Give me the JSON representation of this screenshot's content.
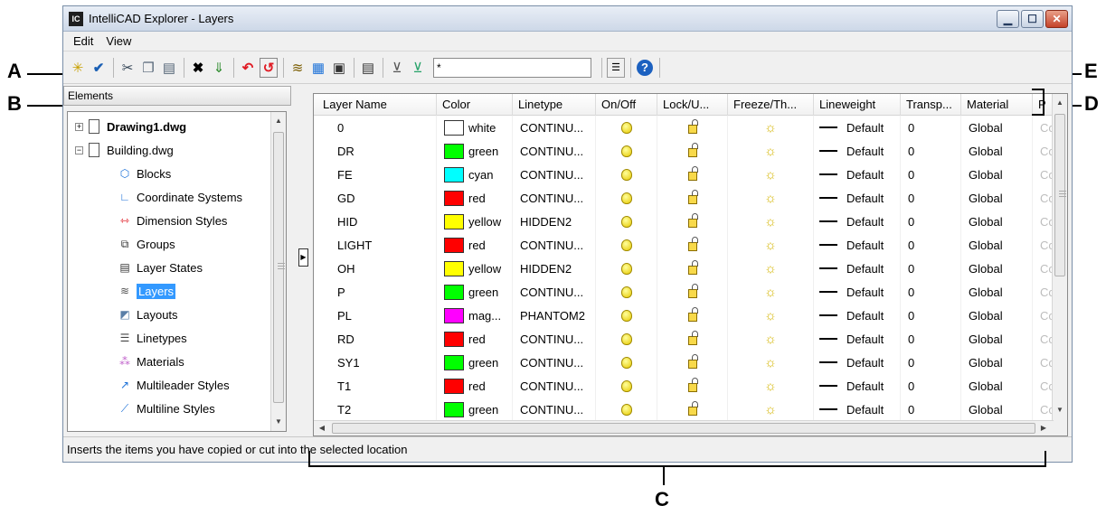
{
  "callouts": {
    "a": "A",
    "b": "B",
    "c": "C",
    "d": "D",
    "e": "E"
  },
  "window": {
    "title": "IntelliCAD Explorer - Layers",
    "app_icon_text": "IC"
  },
  "menu": [
    "Edit",
    "View"
  ],
  "toolbar": {
    "filter_value": "*",
    "help_glyph": "?"
  },
  "left": {
    "header": "Elements",
    "tree": [
      {
        "label": "Drawing1.dwg",
        "bold": true
      },
      {
        "label": "Building.dwg"
      },
      {
        "label": "Blocks",
        "icon": "blocks-icon"
      },
      {
        "label": "Coordinate Systems",
        "icon": "coordinate-systems-icon"
      },
      {
        "label": "Dimension Styles",
        "icon": "dimension-styles-icon"
      },
      {
        "label": "Groups",
        "icon": "groups-icon"
      },
      {
        "label": "Layer States",
        "icon": "layer-states-icon"
      },
      {
        "label": "Layers",
        "icon": "layers-icon",
        "selected": true
      },
      {
        "label": "Layouts",
        "icon": "layouts-icon"
      },
      {
        "label": "Linetypes",
        "icon": "linetypes-icon"
      },
      {
        "label": "Materials",
        "icon": "materials-icon"
      },
      {
        "label": "Multileader Styles",
        "icon": "multileader-styles-icon"
      },
      {
        "label": "Multiline Styles",
        "icon": "multiline-styles-icon"
      }
    ]
  },
  "grid": {
    "columns": [
      "Layer Name",
      "Color",
      "Linetype",
      "On/Off",
      "Lock/U...",
      "Freeze/Th...",
      "Lineweight",
      "Transp...",
      "Material",
      "P"
    ],
    "rows": [
      {
        "name": "0",
        "color": "white",
        "color_hex": "#ffffff",
        "linetype": "CONTINU...",
        "lineweight": "Default",
        "transparency": "0",
        "material": "Global",
        "p": "Co"
      },
      {
        "name": "DR",
        "color": "green",
        "color_hex": "#00ff00",
        "linetype": "CONTINU...",
        "lineweight": "Default",
        "transparency": "0",
        "material": "Global",
        "p": "Co"
      },
      {
        "name": "FE",
        "color": "cyan",
        "color_hex": "#00ffff",
        "linetype": "CONTINU...",
        "lineweight": "Default",
        "transparency": "0",
        "material": "Global",
        "p": "Co"
      },
      {
        "name": "GD",
        "color": "red",
        "color_hex": "#ff0000",
        "linetype": "CONTINU...",
        "lineweight": "Default",
        "transparency": "0",
        "material": "Global",
        "p": "Co"
      },
      {
        "name": "HID",
        "color": "yellow",
        "color_hex": "#ffff00",
        "linetype": "HIDDEN2",
        "lineweight": "Default",
        "transparency": "0",
        "material": "Global",
        "p": "Co"
      },
      {
        "name": "LIGHT",
        "color": "red",
        "color_hex": "#ff0000",
        "linetype": "CONTINU...",
        "lineweight": "Default",
        "transparency": "0",
        "material": "Global",
        "p": "Co"
      },
      {
        "name": "OH",
        "color": "yellow",
        "color_hex": "#ffff00",
        "linetype": "HIDDEN2",
        "lineweight": "Default",
        "transparency": "0",
        "material": "Global",
        "p": "Co"
      },
      {
        "name": "P",
        "color": "green",
        "color_hex": "#00ff00",
        "linetype": "CONTINU...",
        "lineweight": "Default",
        "transparency": "0",
        "material": "Global",
        "p": "Co"
      },
      {
        "name": "PL",
        "color": "mag...",
        "color_hex": "#ff00ff",
        "linetype": "PHANTOM2",
        "lineweight": "Default",
        "transparency": "0",
        "material": "Global",
        "p": "Co"
      },
      {
        "name": "RD",
        "color": "red",
        "color_hex": "#ff0000",
        "linetype": "CONTINU...",
        "lineweight": "Default",
        "transparency": "0",
        "material": "Global",
        "p": "Co"
      },
      {
        "name": "SY1",
        "color": "green",
        "color_hex": "#00ff00",
        "linetype": "CONTINU...",
        "lineweight": "Default",
        "transparency": "0",
        "material": "Global",
        "p": "Co"
      },
      {
        "name": "T1",
        "color": "red",
        "color_hex": "#ff0000",
        "linetype": "CONTINU...",
        "lineweight": "Default",
        "transparency": "0",
        "material": "Global",
        "p": "Co"
      },
      {
        "name": "T2",
        "color": "green",
        "color_hex": "#00ff00",
        "linetype": "CONTINU...",
        "lineweight": "Default",
        "transparency": "0",
        "material": "Global",
        "p": "Co"
      }
    ]
  },
  "status": "Inserts the items you have copied or cut into the selected location"
}
